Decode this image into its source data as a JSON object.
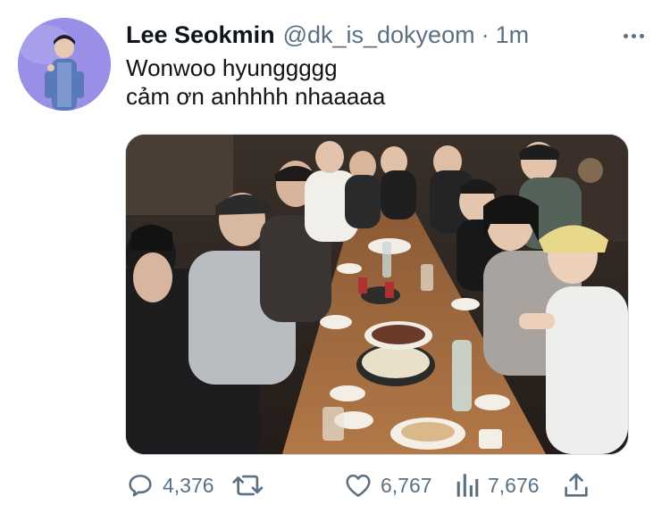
{
  "tweet": {
    "display_name": "Lee Seokmin",
    "handle": "@dk_is_dokyeom",
    "separator": "·",
    "time": "1m",
    "text_lines": [
      "Wonwoo hyunggggg",
      "cảm ơn anhhhh nhaaaaa"
    ]
  },
  "icons": {
    "avatar": "profile-photo",
    "more": "more-horizontal-icon",
    "reply": "reply-icon",
    "retweet": "retweet-icon",
    "like": "heart-icon",
    "views": "views-bar-chart-icon",
    "share": "share-icon"
  },
  "actions": {
    "reply_count": "4,376",
    "like_count": "6,767",
    "views_count": "7,676"
  },
  "colors": {
    "text": "#0f1419",
    "secondary": "#5b7083",
    "border": "#cfd9de",
    "avatar_bg": "#8d7fe0"
  }
}
